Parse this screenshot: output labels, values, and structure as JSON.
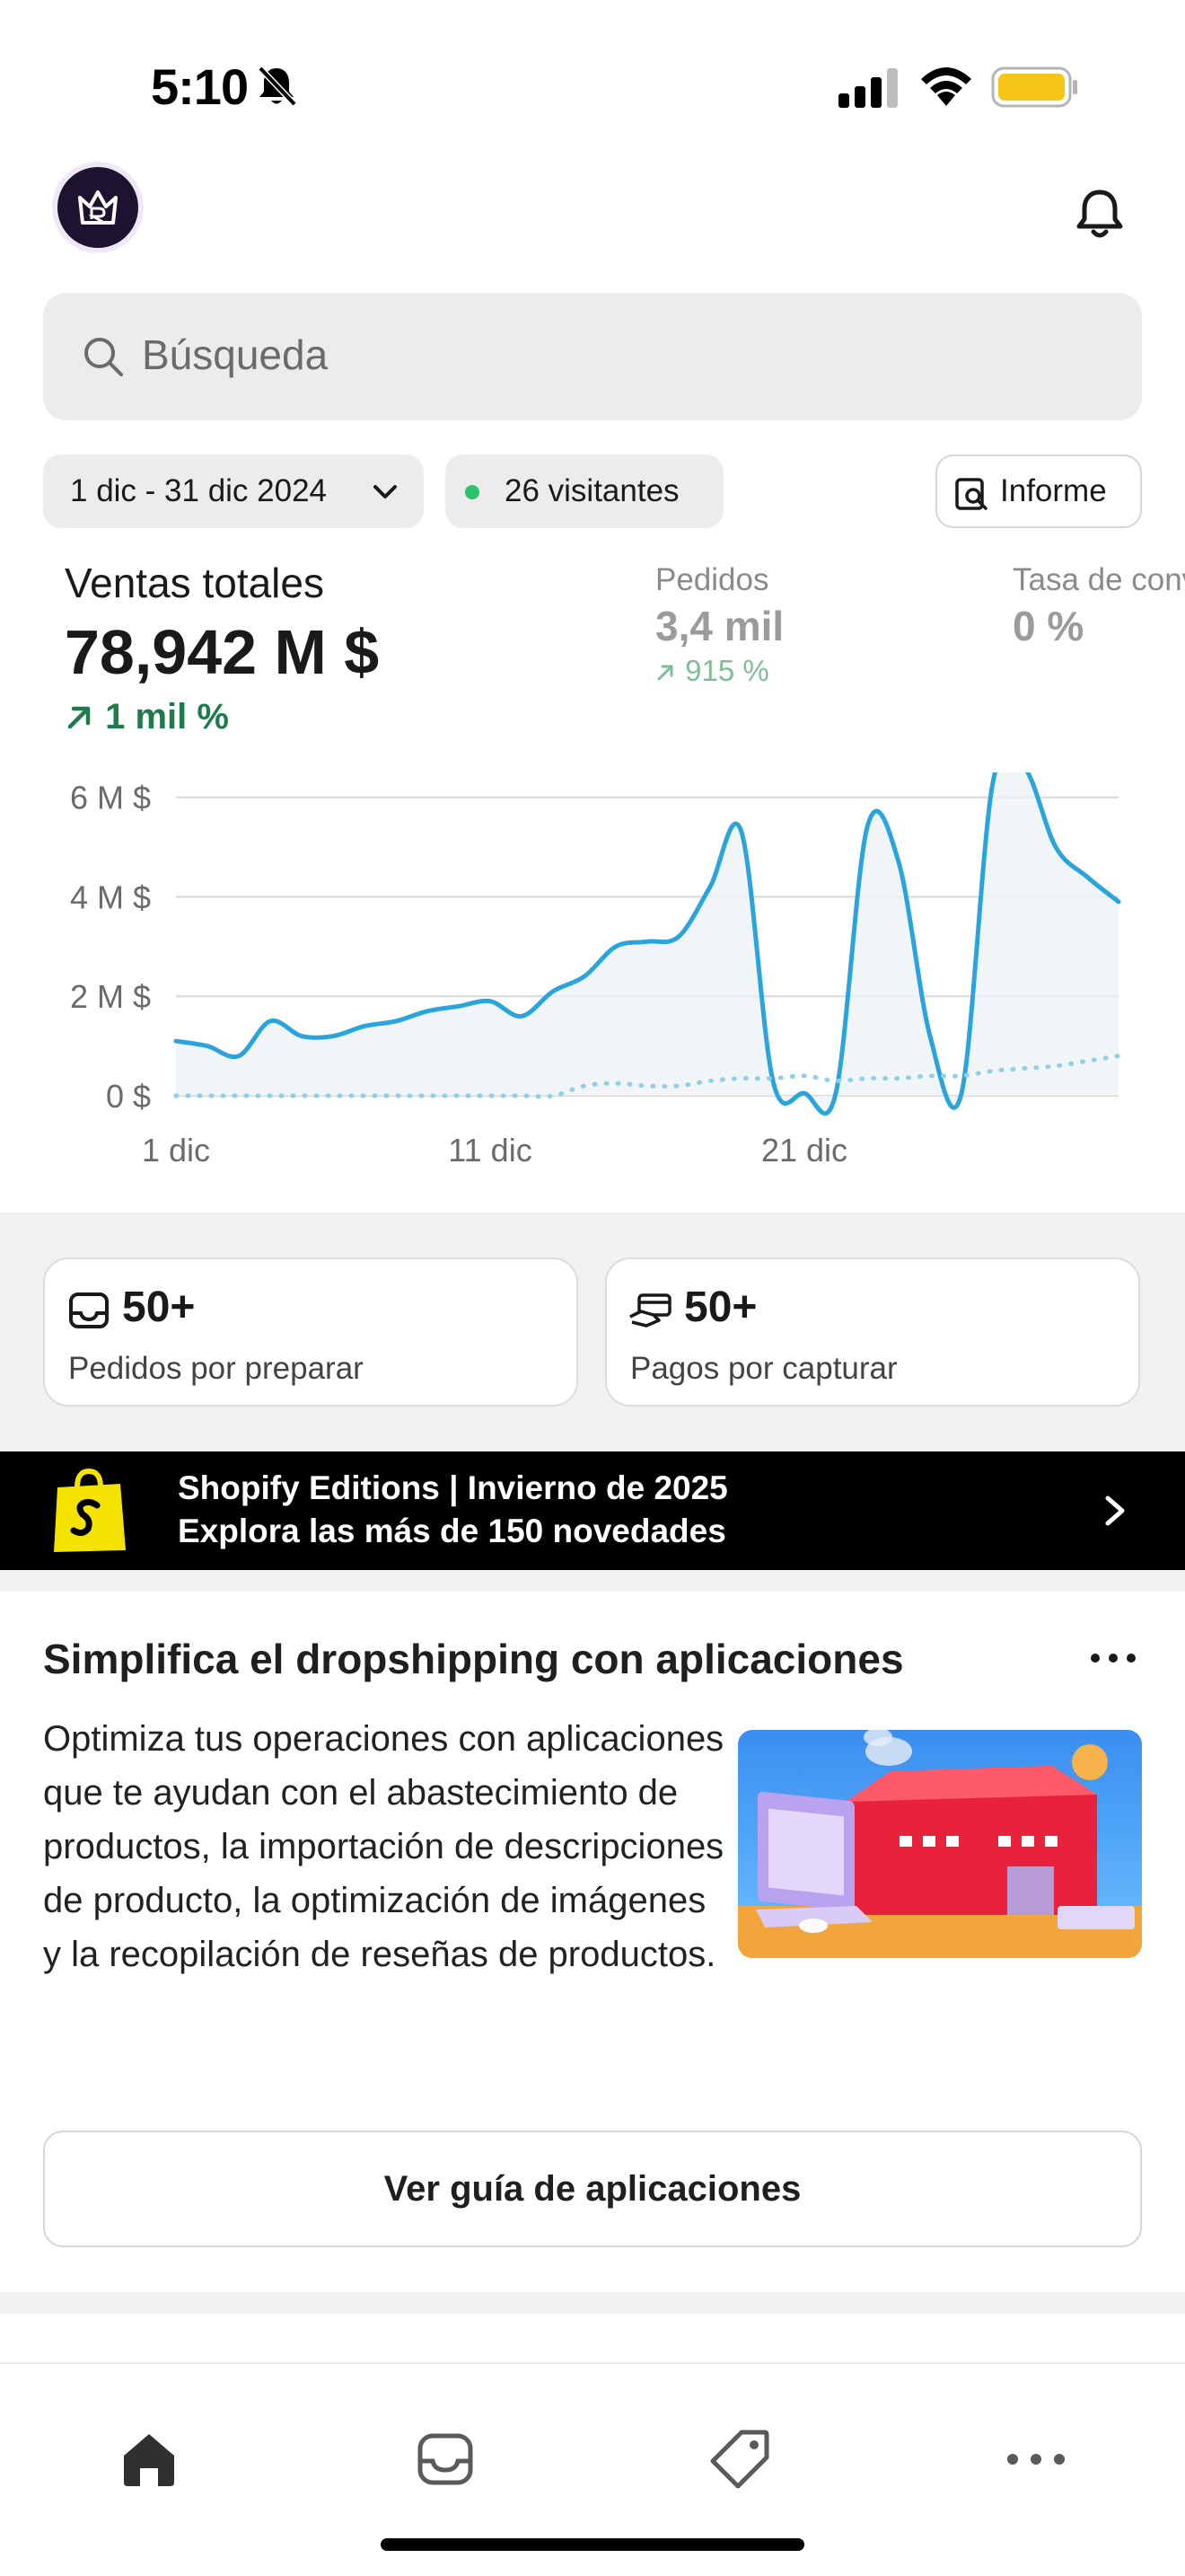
{
  "status_bar": {
    "time": "5:10"
  },
  "header": {
    "logo_icon": "store-crown-logo",
    "notifications_icon": "bell-icon"
  },
  "search": {
    "placeholder": "Búsqueda"
  },
  "filters": {
    "date_range": "1 dic - 31 dic 2024",
    "visitors": "26 visitantes",
    "report_label": "Informe"
  },
  "metrics": {
    "total_sales": {
      "label": "Ventas totales",
      "value": "78,942 M $",
      "change": "1 mil %"
    },
    "orders": {
      "label": "Pedidos",
      "value": "3,4 mil",
      "change": "915 %"
    },
    "conversion": {
      "label": "Tasa de conversión",
      "value": "0 %"
    }
  },
  "chart_data": {
    "type": "line",
    "x": [
      "1 dic",
      "2 dic",
      "3 dic",
      "4 dic",
      "5 dic",
      "6 dic",
      "7 dic",
      "8 dic",
      "9 dic",
      "10 dic",
      "11 dic",
      "12 dic",
      "13 dic",
      "14 dic",
      "15 dic",
      "16 dic",
      "17 dic",
      "18 dic",
      "19 dic",
      "20 dic",
      "21 dic",
      "22 dic",
      "23 dic",
      "24 dic",
      "25 dic",
      "26 dic",
      "27 dic",
      "28 dic",
      "29 dic",
      "30 dic",
      "31 dic"
    ],
    "x_tick_labels": [
      "1 dic",
      "11 dic",
      "21 dic"
    ],
    "y_tick_labels": [
      "0 $",
      "2 M $",
      "4 M $",
      "6 M $"
    ],
    "ylim": [
      0,
      6.5
    ],
    "y_unit": "M $",
    "series": [
      {
        "values": [
          1.1,
          1.0,
          0.8,
          1.5,
          1.2,
          1.2,
          1.4,
          1.5,
          1.7,
          1.8,
          1.9,
          1.6,
          2.1,
          2.4,
          3.0,
          3.1,
          3.2,
          4.2,
          5.3,
          0.3,
          0.05,
          0.05,
          5.4,
          4.7,
          1.2,
          0.05,
          6.3,
          6.6,
          5.0,
          4.4,
          3.9
        ],
        "color": "#2aa4dc",
        "style": "solid"
      },
      {
        "values": [
          0,
          0,
          0,
          0,
          0,
          0,
          0,
          0,
          0,
          0,
          0,
          0,
          0,
          0.2,
          0.25,
          0.2,
          0.2,
          0.3,
          0.35,
          0.35,
          0.4,
          0.3,
          0.35,
          0.35,
          0.4,
          0.4,
          0.5,
          0.55,
          0.6,
          0.7,
          0.8
        ],
        "color": "#8fd0e8",
        "style": "dotted"
      }
    ]
  },
  "tasks": [
    {
      "count": "50+",
      "label": "Pedidos por preparar",
      "icon": "inbox-icon"
    },
    {
      "count": "50+",
      "label": "Pagos por capturar",
      "icon": "payment-icon"
    }
  ],
  "promo": {
    "line1": "Shopify Editions | Invierno de 2025",
    "line2": "Explora las más de 150 novedades",
    "icon": "shopify-bag-icon"
  },
  "guide": {
    "title": "Simplifica el dropshipping con aplicaciones",
    "body": "Optimiza tus operaciones con aplicaciones que te ayudan con el abastecimiento de productos, la importación de descripciones de producto, la optimización de imágenes y la recopilación de reseñas de productos.",
    "button": "Ver guía de aplicaciones"
  },
  "tabs": [
    {
      "name": "home",
      "icon": "home-icon"
    },
    {
      "name": "orders",
      "icon": "inbox-icon"
    },
    {
      "name": "products",
      "icon": "tag-icon"
    },
    {
      "name": "more",
      "icon": "more-icon"
    }
  ],
  "colors": {
    "accent_green": "#1e7c4c",
    "chart_line": "#2aa4dc",
    "promo_bg": "#000000"
  }
}
